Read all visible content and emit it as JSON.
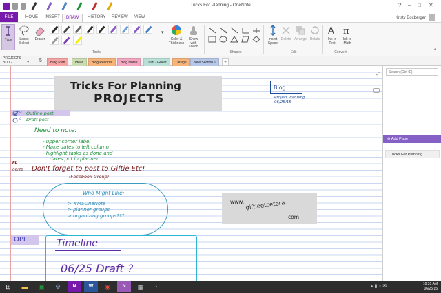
{
  "window": {
    "title": "Tricks For Planning - OneNote",
    "user": "Kristy Boxberger"
  },
  "ribbon_tabs": [
    "FILE",
    "HOME",
    "INSERT",
    "DRAW",
    "HISTORY",
    "REVIEW",
    "VIEW"
  ],
  "ribbon": {
    "type": "Type",
    "lasso": "Lasso Select",
    "eraser": "Eraser",
    "color_thickness": "Color & Thickness",
    "show_touch": "Show with Touch",
    "insert_space": "Insert Space",
    "delete": "Delete",
    "arrange": "Arrange",
    "rotate": "Rotate",
    "ink_text": "Ink to Text",
    "ink_math": "Ink to Math",
    "groups": {
      "tools": "Tools",
      "shapes": "Shapes",
      "edit": "Edit",
      "convert": "Convert"
    }
  },
  "pen_colors": [
    "#2b2b2b",
    "#4a4a4a",
    "#6a6a6a",
    "#2b2b2b",
    "#2b2b2b",
    "#8a5ac6",
    "#6a9fd8",
    "#8a5ac6",
    "#4b82c8",
    "#9a9a9a",
    "#7c3fb0",
    "#f5f000"
  ],
  "notebook": {
    "label": "PROJECTS BLOG",
    "number": "5"
  },
  "sections": [
    {
      "name": "Blog Plan",
      "color": "#f6a3a3"
    },
    {
      "name": "Ideas",
      "color": "#c9dcb2"
    },
    {
      "name": "Blog Records",
      "color": "#f6b47a"
    },
    {
      "name": "Blog Notes",
      "color": "#f2a6bf"
    },
    {
      "name": "Draft - Guest",
      "color": "#b9e0d6"
    },
    {
      "name": "Design",
      "color": "#f6b47a"
    },
    {
      "name": "New Section 1",
      "color": "#b7c7ea"
    }
  ],
  "add_section": "+",
  "search": {
    "placeholder": "Search (Ctrl+E)"
  },
  "add_page": "Add Page",
  "pages": [
    "Tricks For Planning"
  ],
  "note": {
    "title_line1": "Tricks For Planning",
    "title_line2": "PROJECTS",
    "blog": "Blog",
    "blog_sub1": "Project Planning",
    "blog_sub2": "06/25/15",
    "tag1": "PL",
    "item1": "Outline post",
    "tag2": "C",
    "item2": "Draft post",
    "need_to_note": "Need to note:",
    "bullets": [
      "- upper corner label",
      "- Make dates to left column",
      "- highlight tasks as done and",
      "dates put in planner"
    ],
    "pl_mark": "PL",
    "date": "06/28",
    "dont_forget": "Don't forget to post to Giftie Etc!",
    "facebook": "(Facebook Group)",
    "who_might_like": "Who Might Like:",
    "who_items": [
      "> #MSOneNote",
      "> planner groups",
      "> organizing groups???"
    ],
    "website_lines": [
      "www.",
      "giftieetcetera.",
      "com"
    ],
    "opl": "OPL",
    "timeline": "Timeline",
    "timeline_entry": "06/25  Draft ?"
  },
  "taskbar": {
    "time": "10:31 AM",
    "date": "06/25/15"
  }
}
